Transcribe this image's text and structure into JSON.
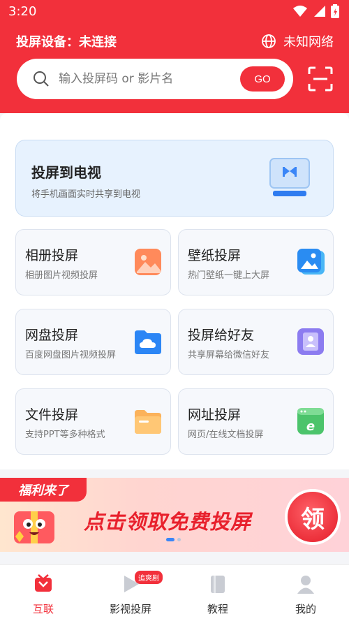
{
  "status": {
    "time": "3:20"
  },
  "header": {
    "device_label": "投屏设备：未连接",
    "network_label": "未知网络"
  },
  "search": {
    "placeholder": "输入投屏码 or 影片名",
    "go_label": "GO"
  },
  "hero": {
    "title": "投屏到电视",
    "subtitle": "将手机画面实时共享到电视"
  },
  "cards": [
    {
      "title": "相册投屏",
      "subtitle": "相册图片视频投屏",
      "icon": "photo-icon"
    },
    {
      "title": "壁纸投屏",
      "subtitle": "热门壁纸一键上大屏",
      "icon": "wallpaper-icon"
    },
    {
      "title": "网盘投屏",
      "subtitle": "百度网盘图片视频投屏",
      "icon": "cloud-folder-icon"
    },
    {
      "title": "投屏给好友",
      "subtitle": "共享屏幕给微信好友",
      "icon": "contact-icon"
    },
    {
      "title": "文件投屏",
      "subtitle": "支持PPT等多种格式",
      "icon": "file-folder-icon"
    },
    {
      "title": "网址投屏",
      "subtitle": "网页/在线文档投屏",
      "icon": "browser-icon"
    }
  ],
  "banner": {
    "tag": "福利来了",
    "headline": "点击领取免费投屏",
    "button": "领",
    "slides_total": 2,
    "slide_active": 1
  },
  "tabs": [
    {
      "label": "互联",
      "active": true
    },
    {
      "label": "影视投屏",
      "badge": "追爽剧"
    },
    {
      "label": "教程"
    },
    {
      "label": "我的"
    }
  ],
  "colors": {
    "brand": "#f2303b",
    "hero_bg": "#e7f2fe",
    "card_bg": "#f6f8fc"
  }
}
